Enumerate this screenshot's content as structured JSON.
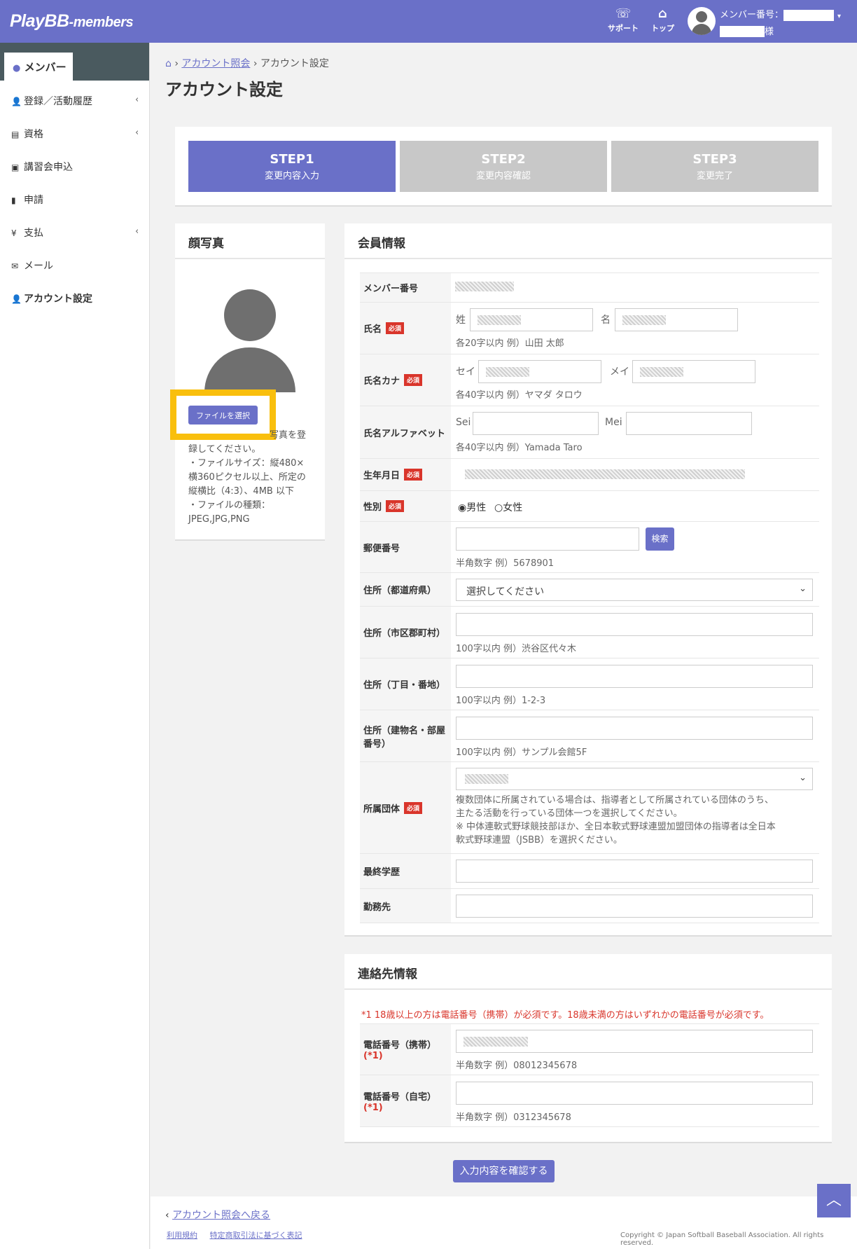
{
  "header": {
    "logo_main": "PlayBB",
    "logo_sub": "-members",
    "support_label": "サポート",
    "top_label": "トップ",
    "member_no_label": "メンバー番号：",
    "honorific": "様"
  },
  "sidebar": {
    "tab": "メンバー",
    "items": [
      {
        "label": "登録／活動履歴",
        "icon": "user-icon"
      },
      {
        "label": "資格",
        "icon": "id-card-icon"
      },
      {
        "label": "講習会申込",
        "icon": "board-icon"
      },
      {
        "label": "申請",
        "icon": "document-icon"
      },
      {
        "label": "支払",
        "icon": "yen-icon"
      },
      {
        "label": "メール",
        "icon": "envelope-icon"
      },
      {
        "label": "アカウント設定",
        "icon": "user-gear-icon"
      }
    ]
  },
  "breadcrumb": {
    "link": "アカウント照会",
    "current": "アカウント設定"
  },
  "page_title": "アカウント設定",
  "steps": [
    {
      "title": "STEP1",
      "sub": "変更内容入力",
      "active": true
    },
    {
      "title": "STEP2",
      "sub": "変更内容確認",
      "active": false
    },
    {
      "title": "STEP3",
      "sub": "変更完了",
      "active": false
    }
  ],
  "photo": {
    "title": "顔写真",
    "file_button": "ファイルを選択",
    "note_line1": "写真を登",
    "note_line2": "録してください。",
    "note_line3": "・ファイルサイズ：縦480×",
    "note_line4": "横360ピクセル以上、所定の",
    "note_line5": "縦横比（4:3）、4MB 以下",
    "note_line6": "・ファイルの種類：",
    "note_line7": "JPEG,JPG,PNG"
  },
  "member": {
    "title": "会員情報",
    "required": "必須",
    "member_no": "メンバー番号",
    "name": "氏名",
    "name_sei": "姓",
    "name_mei": "名",
    "name_hint": "各20字以内 例）山田 太郎",
    "kana": "氏名カナ",
    "kana_sei": "セイ",
    "kana_mei": "メイ",
    "kana_hint": "各40字以内 例）ヤマダ タロウ",
    "alpha": "氏名アルファベット",
    "alpha_sei": "Sei",
    "alpha_mei": "Mei",
    "alpha_hint": "各40字以内 例）Yamada Taro",
    "birth": "生年月日",
    "gender": "性別",
    "male": "男性",
    "female": "女性",
    "zip": "郵便番号",
    "search": "検索",
    "zip_hint": "半角数字 例）5678901",
    "pref": "住所（都道府県）",
    "pref_value": "選択してください",
    "city": "住所（市区郡町村）",
    "city_hint": "100字以内 例）渋谷区代々木",
    "block": "住所（丁目・番地）",
    "block_hint": "100字以内 例）1-2-3",
    "building": "住所（建物名・部屋番号）",
    "building_hint": "100字以内 例）サンプル会館5F",
    "org": "所属団体",
    "org_note1": "複数団体に所属されている場合は、指導者として所属されている団体のうち、",
    "org_note2": "主たる活動を行っている団体一つを選択してください。",
    "org_note3": "※ 中体連軟式野球競技部ほか、全日本軟式野球連盟加盟団体の指導者は全日本",
    "org_note4": "軟式野球連盟（JSBB）を選択ください。",
    "edu": "最終学歴",
    "work": "勤務先"
  },
  "contact": {
    "title": "連絡先情報",
    "warning": "*1 18歳以上の方は電話番号（携帯）が必須です。18歳未満の方はいずれかの電話番号が必須です。",
    "mobile": "電話番号（携帯）",
    "mobile_mark": "(*1)",
    "mobile_hint": "半角数字 例）08012345678",
    "home": "電話番号（自宅）",
    "home_mark": "(*1)",
    "home_hint": "半角数字 例）0312345678"
  },
  "confirm_button": "入力内容を確認する",
  "footer": {
    "back": "アカウント照会へ戻る",
    "terms": "利用規約",
    "law": "特定商取引法に基づく表記",
    "copyright": "Copyright © Japan Softball Baseball Association. All rights reserved."
  },
  "colors": {
    "brand": "#6a70c8",
    "required": "#d9352b",
    "highlight": "#f9bf0d"
  }
}
